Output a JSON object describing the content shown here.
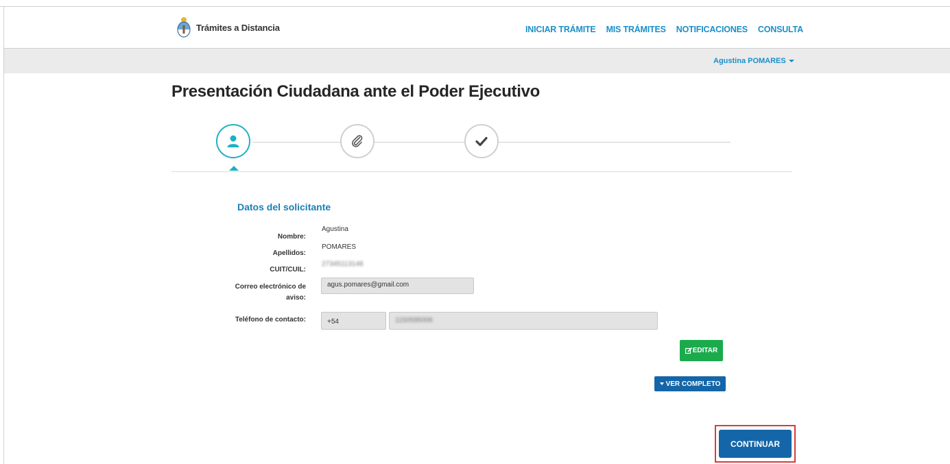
{
  "header": {
    "brand_name": "Trámites a Distancia",
    "nav": [
      {
        "label": "INICIAR TRÁMITE"
      },
      {
        "label": "MIS TRÁMITES"
      },
      {
        "label": "NOTIFICACIONES"
      },
      {
        "label": "CONSULTA"
      }
    ]
  },
  "userbar": {
    "user_name": "Agustina POMARES"
  },
  "page": {
    "title": "Presentación Ciudadana ante el Poder Ejecutivo"
  },
  "steps": [
    {
      "icon": "user-icon",
      "active": true
    },
    {
      "icon": "paperclip-icon",
      "active": false
    },
    {
      "icon": "check-icon",
      "active": false
    }
  ],
  "applicant": {
    "section_title": "Datos del solicitante",
    "nombre_label": "Nombre:",
    "nombre_value": "Agustina",
    "apellidos_label": "Apellidos:",
    "apellidos_value": "POMARES",
    "cuit_label": "CUIT/CUIL:",
    "cuit_value": "27345113148",
    "email_label": "Correo electrónico de aviso:",
    "email_value": "agus.pomares@gmail.com",
    "phone_label": "Teléfono de contacto:",
    "phone_prefix": "+54",
    "phone_number": "1150595006"
  },
  "actions": {
    "edit_label": "EDITAR",
    "ver_completo_label": "VER COMPLETO",
    "continue_label": "CONTINUAR"
  },
  "colors": {
    "accent": "#1a8fc9",
    "step_active": "#1eb0c4",
    "edit_green": "#1bab4c",
    "primary_blue": "#1566a8",
    "highlight_red": "#d23d3d"
  }
}
